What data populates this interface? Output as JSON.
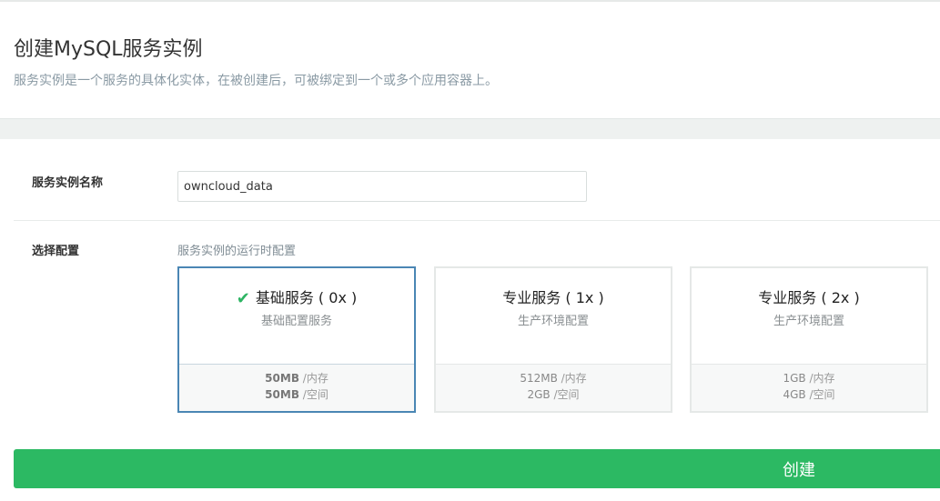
{
  "header": {
    "title": "创建MySQL服务实例",
    "subtitle": "服务实例是一个服务的具体化实体，在被创建后，可被绑定到一个或多个应用容器上。"
  },
  "form": {
    "name_label": "服务实例名称",
    "name_value": "owncloud_data",
    "config_label": "选择配置",
    "config_hint": "服务实例的运行时配置"
  },
  "plans": [
    {
      "name": "基础服务 ( 0x )",
      "desc": "基础配置服务",
      "memory": "50MB",
      "memory_unit": " /内存",
      "disk": "50MB",
      "disk_unit": " /空间",
      "selected": true
    },
    {
      "name": "专业服务 ( 1x )",
      "desc": "生产环境配置",
      "memory": "512MB",
      "memory_unit": " /内存",
      "disk": "2GB",
      "disk_unit": " /空间",
      "selected": false
    },
    {
      "name": "专业服务 ( 2x )",
      "desc": "生产环境配置",
      "memory": "1GB",
      "memory_unit": " /内存",
      "disk": "4GB",
      "disk_unit": " /空间",
      "selected": false
    }
  ],
  "icons": {
    "selected_check": "check-icon"
  },
  "colors": {
    "accent_green": "#2cb963",
    "selected_border": "#4a86b4",
    "check_green": "#2db463"
  },
  "actions": {
    "create_label": "创建"
  }
}
